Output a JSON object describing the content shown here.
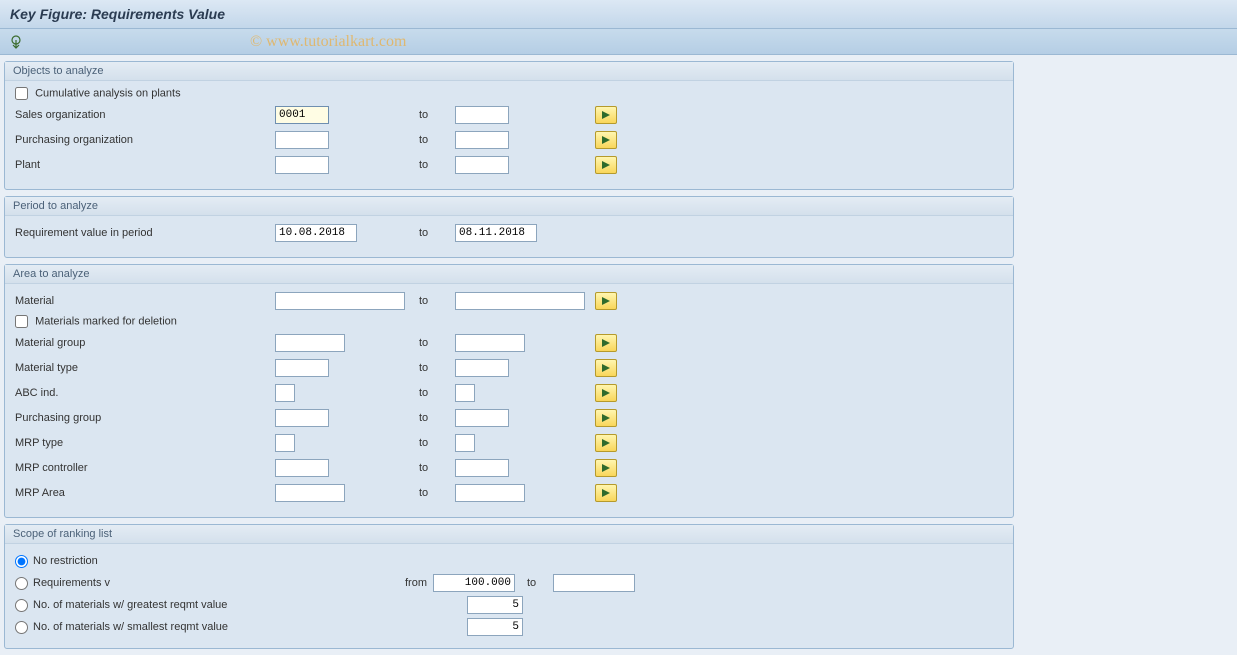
{
  "title": "Key Figure: Requirements Value",
  "watermark": "© www.tutorialkart.com",
  "labels": {
    "to": "to",
    "from": "from"
  },
  "groups": {
    "objects": {
      "title": "Objects to analyze",
      "cumulative_label": "Cumulative analysis on plants",
      "cumulative_checked": false,
      "sales_org": {
        "label": "Sales organization",
        "from": "0001",
        "to": ""
      },
      "purch_org": {
        "label": "Purchasing organization",
        "from": "",
        "to": ""
      },
      "plant": {
        "label": "Plant",
        "from": "",
        "to": ""
      }
    },
    "period": {
      "title": "Period to analyze",
      "req_value": {
        "label": "Requirement value in period",
        "from": "10.08.2018",
        "to": "08.11.2018"
      }
    },
    "area": {
      "title": "Area to analyze",
      "material": {
        "label": "Material",
        "from": "",
        "to": ""
      },
      "del_label": "Materials marked for deletion",
      "del_checked": false,
      "matgroup": {
        "label": "Material group",
        "from": "",
        "to": ""
      },
      "mattype": {
        "label": "Material type",
        "from": "",
        "to": ""
      },
      "abc": {
        "label": "ABC ind.",
        "from": "",
        "to": ""
      },
      "pgroup": {
        "label": "Purchasing group",
        "from": "",
        "to": ""
      },
      "mrptype": {
        "label": "MRP type",
        "from": "",
        "to": ""
      },
      "mrpctrl": {
        "label": "MRP controller",
        "from": "",
        "to": ""
      },
      "mrparea": {
        "label": "MRP Area",
        "from": "",
        "to": ""
      }
    },
    "scope": {
      "title": "Scope of ranking list",
      "no_restriction": {
        "label": "No restriction",
        "selected": true
      },
      "req_v": {
        "label": "Requirements v",
        "selected": false,
        "from": "100.000",
        "to": ""
      },
      "greatest": {
        "label": "No. of materials w/ greatest reqmt value",
        "selected": false,
        "value": "5"
      },
      "smallest": {
        "label": "No. of materials w/ smallest reqmt value",
        "selected": false,
        "value": "5"
      }
    }
  }
}
